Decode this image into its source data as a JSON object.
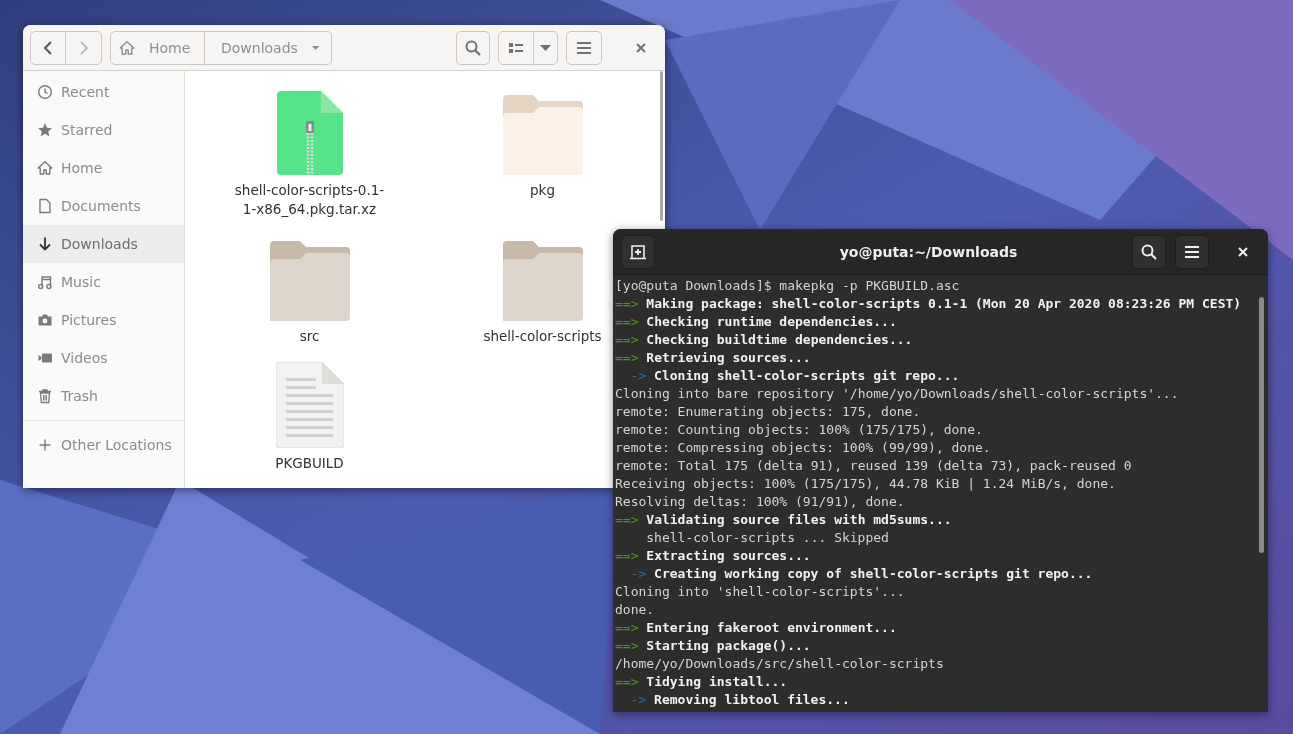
{
  "file_manager": {
    "nav": {
      "back": {
        "disabled": false
      },
      "forward": {
        "disabled": true
      }
    },
    "path": [
      {
        "label": "Home",
        "kind": "home"
      },
      {
        "label": "Downloads",
        "kind": "current"
      }
    ],
    "sidebar": {
      "places": [
        {
          "label": "Recent",
          "selected": false
        },
        {
          "label": "Starred",
          "selected": false
        },
        {
          "label": "Home",
          "selected": false
        },
        {
          "label": "Documents",
          "selected": false
        },
        {
          "label": "Downloads",
          "selected": true
        },
        {
          "label": "Music",
          "selected": false
        },
        {
          "label": "Pictures",
          "selected": false
        },
        {
          "label": "Videos",
          "selected": false
        },
        {
          "label": "Trash",
          "selected": false
        }
      ],
      "other": [
        {
          "label": "Other Locations",
          "selected": false
        }
      ]
    },
    "files": [
      {
        "name": "shell-color-scripts-0.1-1-x86_64.pkg.tar.xz",
        "kind": "archive",
        "hovered": false
      },
      {
        "name": "pkg",
        "kind": "folder",
        "hovered": true
      },
      {
        "name": "src",
        "kind": "folder",
        "hovered": false
      },
      {
        "name": "shell-color-scripts",
        "kind": "folder",
        "hovered": false
      },
      {
        "name": "PKGBUILD",
        "kind": "document",
        "hovered": false
      }
    ]
  },
  "terminal": {
    "title": "yo@puta:~/Downloads",
    "lines": [
      {
        "kind": "plain",
        "text": "[yo@puta Downloads]$ makepkg -p PKGBUILD.asc"
      },
      {
        "kind": "step",
        "arrow": "==>",
        "text": "Making package: shell-color-scripts 0.1-1 (Mon 20 Apr 2020 08:23:26 PM CEST)"
      },
      {
        "kind": "step",
        "arrow": "==>",
        "text": "Checking runtime dependencies..."
      },
      {
        "kind": "step",
        "arrow": "==>",
        "text": "Checking buildtime dependencies..."
      },
      {
        "kind": "step",
        "arrow": "==>",
        "text": "Retrieving sources..."
      },
      {
        "kind": "substep",
        "arrow": "->",
        "text": "Cloning shell-color-scripts git repo..."
      },
      {
        "kind": "plain",
        "text": "Cloning into bare repository '/home/yo/Downloads/shell-color-scripts'..."
      },
      {
        "kind": "plain",
        "text": "remote: Enumerating objects: 175, done."
      },
      {
        "kind": "plain",
        "text": "remote: Counting objects: 100% (175/175), done."
      },
      {
        "kind": "plain",
        "text": "remote: Compressing objects: 100% (99/99), done."
      },
      {
        "kind": "plain",
        "text": "remote: Total 175 (delta 91), reused 139 (delta 73), pack-reused 0"
      },
      {
        "kind": "plain",
        "text": "Receiving objects: 100% (175/175), 44.78 KiB | 1.24 MiB/s, done."
      },
      {
        "kind": "plain",
        "text": "Resolving deltas: 100% (91/91), done."
      },
      {
        "kind": "step",
        "arrow": "==>",
        "text": "Validating source files with md5sums..."
      },
      {
        "kind": "indented",
        "text": "shell-color-scripts ... Skipped"
      },
      {
        "kind": "step",
        "arrow": "==>",
        "text": "Extracting sources..."
      },
      {
        "kind": "substep",
        "arrow": "->",
        "text": "Creating working copy of shell-color-scripts git repo..."
      },
      {
        "kind": "plain",
        "text": "Cloning into 'shell-color-scripts'..."
      },
      {
        "kind": "plain",
        "text": "done."
      },
      {
        "kind": "step",
        "arrow": "==>",
        "text": "Entering fakeroot environment..."
      },
      {
        "kind": "step",
        "arrow": "==>",
        "text": "Starting package()..."
      },
      {
        "kind": "plain",
        "text": "/home/yo/Downloads/src/shell-color-scripts"
      },
      {
        "kind": "step",
        "arrow": "==>",
        "text": "Tidying install..."
      },
      {
        "kind": "substep",
        "arrow": "->",
        "text": "Removing libtool files..."
      }
    ]
  }
}
